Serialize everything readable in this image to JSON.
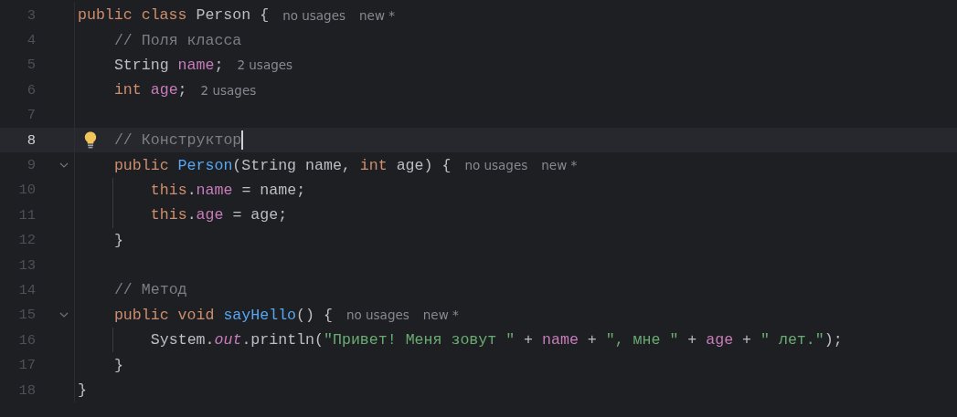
{
  "editor": {
    "lines": [
      {
        "number": "3",
        "tokens": [
          {
            "text": "public class ",
            "kind": "keyword"
          },
          {
            "text": "Person {",
            "kind": "plain"
          }
        ],
        "hints": [
          "no usages",
          "new *"
        ],
        "current": false,
        "foldable": false,
        "caret": false,
        "bulb": false,
        "children": [
          {
            "number": "4",
            "tokens": [
              {
                "text": "// Поля класса",
                "kind": "comment"
              }
            ],
            "current": false,
            "foldable": false,
            "caret": false,
            "bulb": false
          },
          {
            "number": "5",
            "tokens": [
              {
                "text": "String ",
                "kind": "plain"
              },
              {
                "text": "name",
                "kind": "field"
              },
              {
                "text": ";",
                "kind": "plain"
              }
            ],
            "hints": [
              "2 usages"
            ],
            "current": false,
            "foldable": false,
            "caret": false,
            "bulb": false
          },
          {
            "number": "6",
            "tokens": [
              {
                "text": "int ",
                "kind": "keyword"
              },
              {
                "text": "age",
                "kind": "field"
              },
              {
                "text": ";",
                "kind": "plain"
              }
            ],
            "hints": [
              "2 usages"
            ],
            "current": false,
            "foldable": false,
            "caret": false,
            "bulb": false
          },
          {
            "number": "7",
            "current": false,
            "foldable": false,
            "caret": false,
            "bulb": false
          },
          {
            "number": "8",
            "tokens": [
              {
                "text": "// Конструктор",
                "kind": "comment"
              }
            ],
            "current": true,
            "foldable": false,
            "caret": true,
            "bulb": true
          },
          {
            "number": "9",
            "tokens": [
              {
                "text": "public ",
                "kind": "keyword"
              },
              {
                "text": "Person",
                "kind": "declaration"
              },
              {
                "text": "(String name, ",
                "kind": "plain"
              },
              {
                "text": "int ",
                "kind": "keyword"
              },
              {
                "text": "age) {",
                "kind": "plain"
              }
            ],
            "hints": [
              "no usages",
              "new *"
            ],
            "current": false,
            "foldable": true,
            "caret": false,
            "bulb": false,
            "children": [
              {
                "number": "10",
                "tokens": [
                  {
                    "text": "this",
                    "kind": "keyword"
                  },
                  {
                    "text": ".",
                    "kind": "plain"
                  },
                  {
                    "text": "name",
                    "kind": "field"
                  },
                  {
                    "text": " = name;",
                    "kind": "plain"
                  }
                ],
                "current": false,
                "foldable": false,
                "caret": false,
                "bulb": false
              },
              {
                "number": "11",
                "tokens": [
                  {
                    "text": "this",
                    "kind": "keyword"
                  },
                  {
                    "text": ".",
                    "kind": "plain"
                  },
                  {
                    "text": "age",
                    "kind": "field"
                  },
                  {
                    "text": " = age;",
                    "kind": "plain"
                  }
                ],
                "current": false,
                "foldable": false,
                "caret": false,
                "bulb": false
              }
            ]
          },
          {
            "number": "12",
            "tokens": [
              {
                "text": "}",
                "kind": "plain"
              }
            ],
            "current": false,
            "foldable": false,
            "caret": false,
            "bulb": false
          },
          {
            "number": "13",
            "current": false,
            "foldable": false,
            "caret": false,
            "bulb": false
          },
          {
            "number": "14",
            "tokens": [
              {
                "text": "// Метод",
                "kind": "comment"
              }
            ],
            "current": false,
            "foldable": false,
            "caret": false,
            "bulb": false
          },
          {
            "number": "15",
            "tokens": [
              {
                "text": "public void ",
                "kind": "keyword"
              },
              {
                "text": "sayHello",
                "kind": "declaration"
              },
              {
                "text": "() {",
                "kind": "plain"
              }
            ],
            "hints": [
              "no usages",
              "new *"
            ],
            "current": false,
            "foldable": true,
            "caret": false,
            "bulb": false,
            "children": [
              {
                "number": "16",
                "tokens": [
                  {
                    "text": "System.",
                    "kind": "plain"
                  },
                  {
                    "text": "out",
                    "kind": "static"
                  },
                  {
                    "text": ".println(",
                    "kind": "plain"
                  },
                  {
                    "text": "\"Привет! Меня зовут \"",
                    "kind": "string"
                  },
                  {
                    "text": " + ",
                    "kind": "plain"
                  },
                  {
                    "text": "name",
                    "kind": "field"
                  },
                  {
                    "text": " + ",
                    "kind": "plain"
                  },
                  {
                    "text": "\", мне \"",
                    "kind": "string"
                  },
                  {
                    "text": " + ",
                    "kind": "plain"
                  },
                  {
                    "text": "age",
                    "kind": "field"
                  },
                  {
                    "text": " + ",
                    "kind": "plain"
                  },
                  {
                    "text": "\" лет.\"",
                    "kind": "string"
                  },
                  {
                    "text": ");",
                    "kind": "plain"
                  }
                ],
                "current": false,
                "foldable": false,
                "caret": false,
                "bulb": false
              }
            ]
          },
          {
            "number": "17",
            "tokens": [
              {
                "text": "}",
                "kind": "plain"
              }
            ],
            "current": false,
            "foldable": false,
            "caret": false,
            "bulb": false
          }
        ]
      },
      {
        "number": "18",
        "tokens": [
          {
            "text": "}",
            "kind": "plain"
          }
        ],
        "current": false,
        "foldable": false,
        "caret": false,
        "bulb": false
      }
    ]
  }
}
